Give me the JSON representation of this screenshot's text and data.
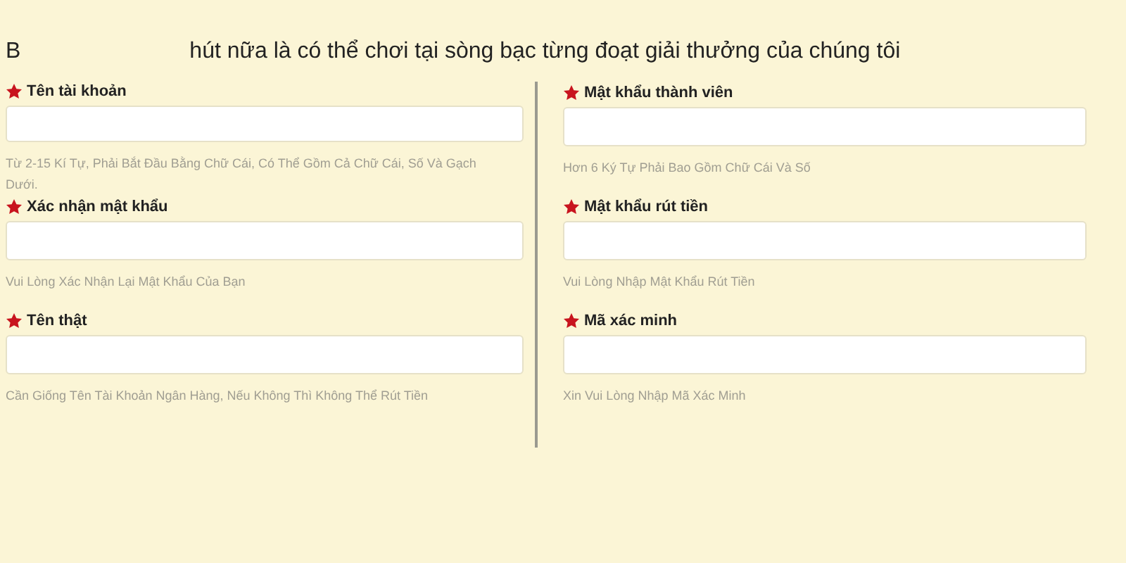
{
  "intro": [
    "B",
    "hút nữa là có thể chơi tại sòng bạc từng đoạt giải thưởng của chúng tôi"
  ],
  "columns": [
    {
      "fields": [
        {
          "label": "Tên tài khoản",
          "required": true,
          "hint": "Từ 2-15 Kí Tự, Phải Bắt Đầu Bằng Chữ Cái, Có Thể Gồm Cả Chữ Cái, Số Và Gạch Dưới."
        },
        {
          "label": "Xác nhận mật khẩu",
          "required": true,
          "hint": "Vui Lòng Xác Nhận Lại Mật Khẩu Của Bạn"
        },
        {
          "label": "Tên thật",
          "required": true,
          "hint": "Cần Giống Tên Tài Khoản Ngân Hàng, Nếu Không Thì Không Thể Rút Tiền"
        }
      ]
    },
    {
      "fields": [
        {
          "label": "Mật khẩu thành viên",
          "required": true,
          "hint": "Hơn 6 Ký Tự Phải Bao Gồm Chữ Cái Và Số"
        },
        {
          "label": "Mật khẩu rút tiền",
          "required": true,
          "hint": "Vui Lòng Nhập Mật Khẩu Rút Tiền"
        },
        {
          "label": "Mã xác minh",
          "required": true,
          "hint": "Xin Vui Lòng Nhập Mã Xác Minh"
        }
      ]
    }
  ]
}
